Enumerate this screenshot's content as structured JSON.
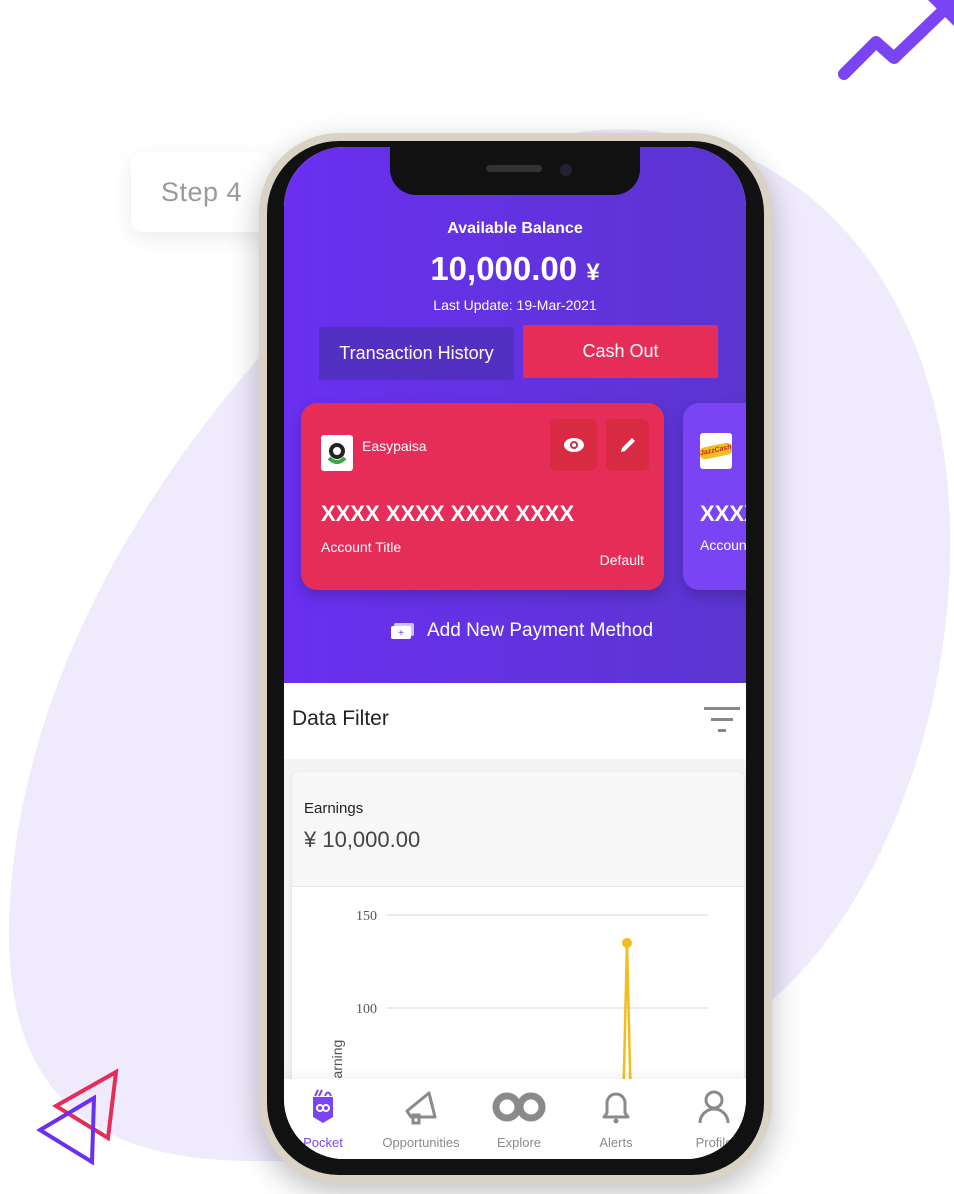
{
  "step_label": "Step 4",
  "balance": {
    "title": "Available Balance",
    "amount": "10,000.00",
    "currency": "¥",
    "last_update": "Last Update: 19-Mar-2021"
  },
  "actions": {
    "history": "Transaction History",
    "cashout": "Cash Out"
  },
  "cards": [
    {
      "provider": "Easypaisa",
      "number": "XXXX XXXX XXXX XXXX",
      "account_title": "Account Title",
      "badge": "Default",
      "color": "#e52d57"
    },
    {
      "provider": "JazzCash",
      "number": "XXXX XXXX XXXX XXXX",
      "account_title": "Account Title",
      "color": "#7a44f5"
    }
  ],
  "add_payment": "Add New Payment Method",
  "filter": {
    "title": "Data Filter"
  },
  "earnings": {
    "label": "Earnings",
    "amount": "¥ 10,000.00"
  },
  "chart_data": {
    "type": "line",
    "ylabel": "Earning",
    "yticks": [
      150,
      100
    ],
    "series": [
      {
        "color": "#f2bd1d",
        "values": [
          {
            "y": 135
          }
        ]
      }
    ],
    "grid": true
  },
  "nav": [
    {
      "label": "Pocket",
      "active": true
    },
    {
      "label": "Opportunities"
    },
    {
      "label": "Explore"
    },
    {
      "label": "Alerts"
    },
    {
      "label": "Profile"
    }
  ],
  "colors": {
    "primary": "#6a2ff0",
    "accent": "#e52d57",
    "active_nav": "#7a44f5",
    "background_blob": "#efeafc"
  }
}
